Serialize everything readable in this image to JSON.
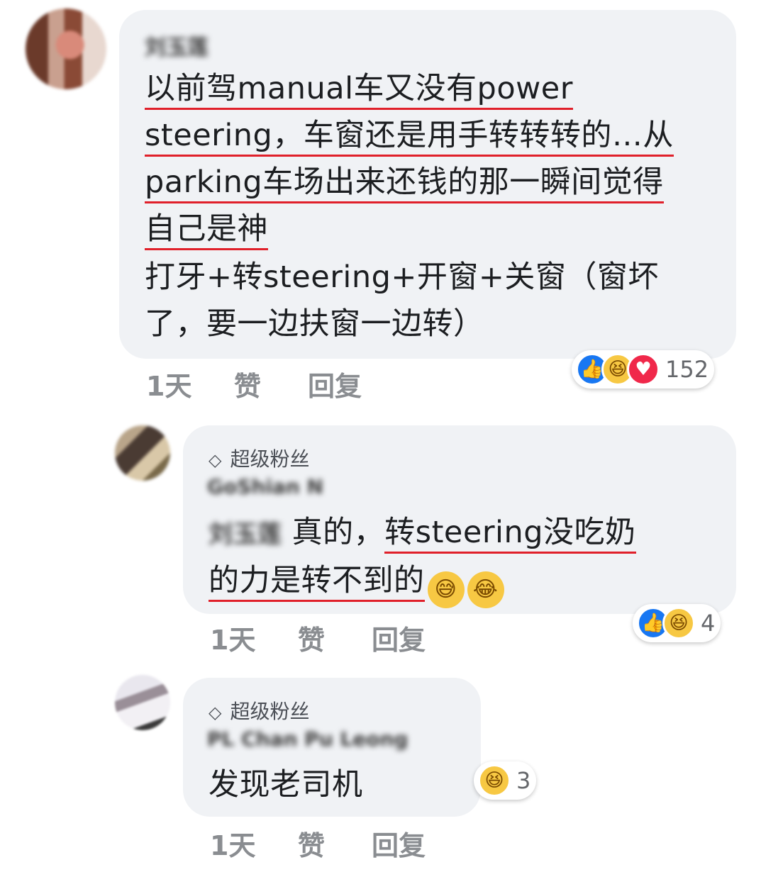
{
  "comments": [
    {
      "author": "刘玉莲",
      "lines": [
        "以前驾manual车又没有power",
        "steering，车窗还是用手转转转的…从",
        "parking车场出来还钱的那一瞬间觉得",
        "自己是神",
        "打牙+转steering+开窗+关窗（窗坏",
        "了，要一边扶窗一边转）"
      ],
      "time": "1天",
      "like": "赞",
      "reply": "回复",
      "reaction_count": "152",
      "reactions": [
        "like-icon",
        "haha-icon",
        "love-icon"
      ]
    },
    {
      "badge": "超级粉丝",
      "author": "GoShian N",
      "mention": "刘玉莲",
      "line1_plain": "真的，",
      "line1_marked": "转steering没吃奶",
      "line2_marked": "的力是转不到的",
      "emojis": [
        "sweat-smile-emoji",
        "tears-of-joy-emoji"
      ],
      "time": "1天",
      "like": "赞",
      "reply": "回复",
      "reaction_count": "4",
      "reactions": [
        "like-icon",
        "haha-icon"
      ]
    },
    {
      "badge": "超级粉丝",
      "author": "PL Chan Pu Leong",
      "text": "发现老司机",
      "time": "1天",
      "like": "赞",
      "reply": "回复",
      "reaction_count": "3",
      "reactions": [
        "haha-icon"
      ]
    }
  ],
  "colors": {
    "bubble": "#f0f2f5",
    "underline": "#e0202a",
    "like": "#1877f2",
    "love": "#f0284a",
    "haha": "#f7c843"
  }
}
